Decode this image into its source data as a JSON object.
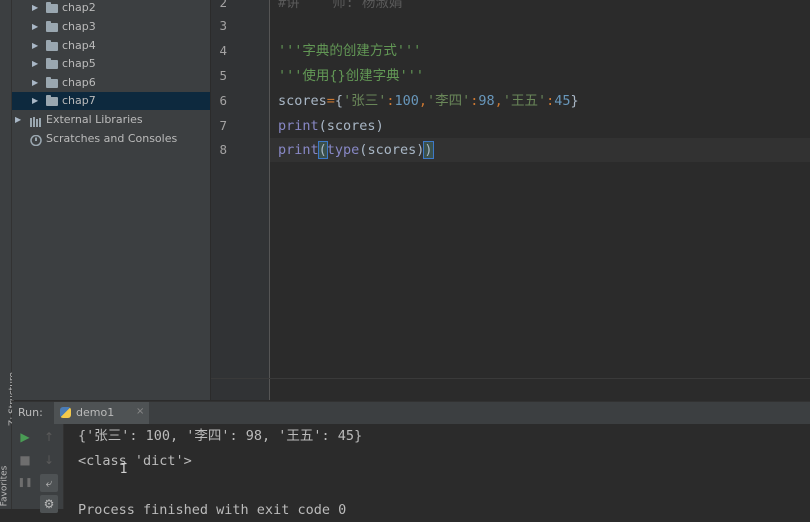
{
  "sidebar": {
    "structure_label": "Z: Structure",
    "favorites_label": "Favorites"
  },
  "project_tree": {
    "items": [
      {
        "label": "chap2",
        "type": "folder",
        "selected": false
      },
      {
        "label": "chap3",
        "type": "folder",
        "selected": false
      },
      {
        "label": "chap4",
        "type": "folder",
        "selected": false
      },
      {
        "label": "chap5",
        "type": "folder",
        "selected": false
      },
      {
        "label": "chap6",
        "type": "folder",
        "selected": false
      },
      {
        "label": "chap7",
        "type": "folder",
        "selected": true
      },
      {
        "label": "External Libraries",
        "type": "library"
      },
      {
        "label": "Scratches and Consoles",
        "type": "scratches"
      }
    ]
  },
  "editor": {
    "line_numbers": [
      "2",
      "3",
      "4",
      "5",
      "6",
      "7",
      "8"
    ],
    "partial_line": "#讲    师: 杨淑娟",
    "line4_comment": "'''字典的创建方式'''",
    "line5_comment": "'''使用{}创建字典'''",
    "line6": {
      "var": "scores",
      "eq": "=",
      "open": "{",
      "key1": "'张三'",
      "colon": ":",
      "val1": "100",
      "comma": ",",
      "key2": "'李四'",
      "val2": "98",
      "key3": "'王五'",
      "val3": "45",
      "close": "}"
    },
    "line7": {
      "fn": "print",
      "open": "(",
      "arg": "scores",
      "close": ")"
    },
    "line8": {
      "fn": "print",
      "open": "(",
      "inner_fn": "type",
      "inner_open": "(",
      "arg": "scores",
      "inner_close": ")",
      "close": ")"
    },
    "current_line": "8"
  },
  "run_panel": {
    "label": "Run:",
    "tab_name": "demo1",
    "tab_close": "×",
    "output": [
      "{'张三': 100, '李四': 98, '王五': 45}",
      "<class 'dict'>",
      "",
      "Process finished with exit code 0"
    ],
    "toolbar": {
      "rerun": "▶",
      "up": "↑",
      "stop": "■",
      "down": "↓",
      "pause": "❚❚",
      "wrap": "⤶",
      "settings": "⚙"
    }
  },
  "colors": {
    "keyword": "#8888c6",
    "number": "#6897bb",
    "string": "#6a8759",
    "operator": "#cc7832",
    "comment": "#629755",
    "run_green": "#499c54"
  }
}
